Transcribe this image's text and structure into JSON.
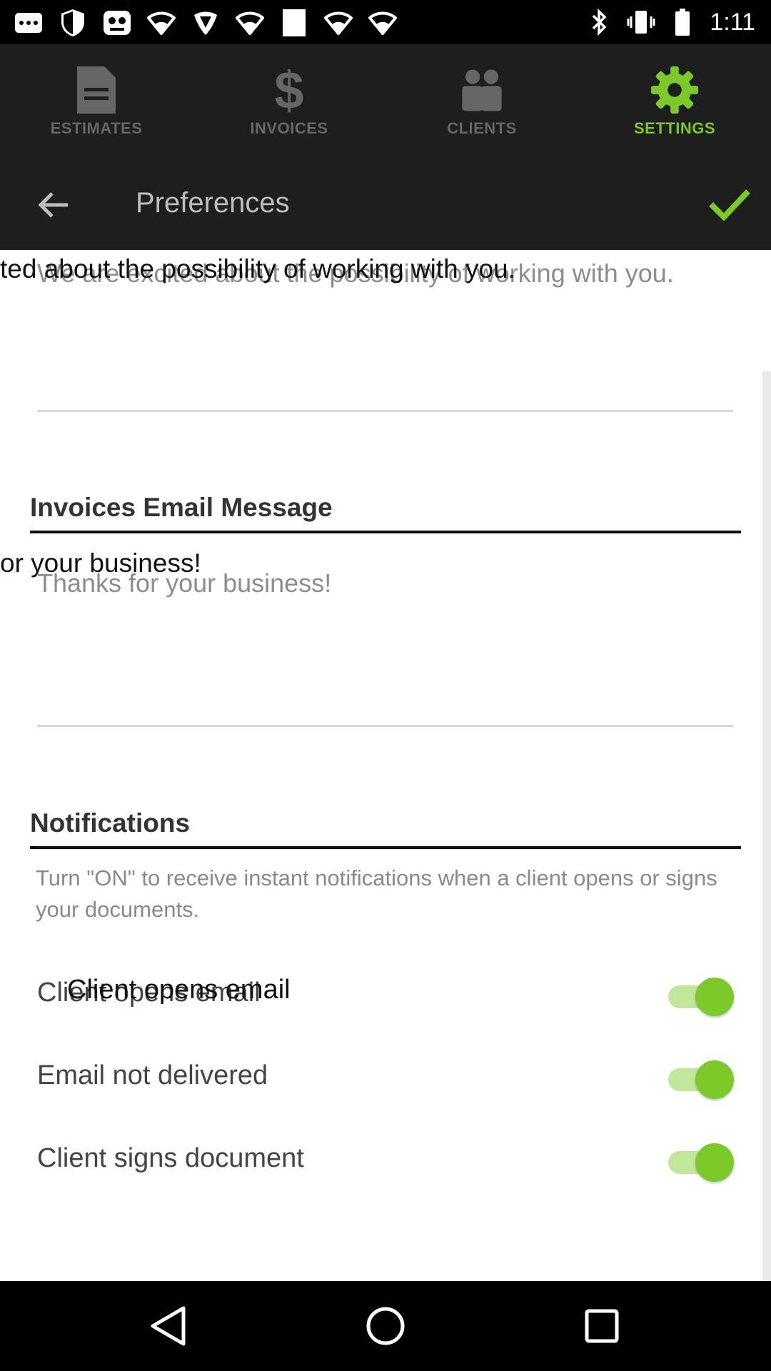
{
  "status_bar": {
    "time": "1:11",
    "icons": [
      "message-icon",
      "shield-icon",
      "app-icon",
      "wifi-icon",
      "houston-texans-icon",
      "wifi-icon",
      "window-icon",
      "wifi-icon",
      "wifi-icon",
      "bluetooth-icon",
      "vibrate-icon",
      "battery-icon"
    ]
  },
  "tabs": [
    {
      "label": "ESTIMATES",
      "icon": "document-icon",
      "active": false
    },
    {
      "label": "INVOICES",
      "icon": "dollar-icon",
      "active": false
    },
    {
      "label": "CLIENTS",
      "icon": "people-icon",
      "active": false
    },
    {
      "label": "SETTINGS",
      "icon": "gear-icon",
      "active": true
    }
  ],
  "toolbar": {
    "title": "Preferences"
  },
  "estimates_email": {
    "value": "We are excited about the possibility of working with you.",
    "overlay_text": "ted about the possibility of working with you."
  },
  "invoices_email": {
    "title": "Invoices Email Message",
    "value": "Thanks for your business!",
    "overlay_text": "or your business!"
  },
  "notifications": {
    "title": "Notifications",
    "description": "Turn \"ON\" to receive instant notifications when a client opens or signs your documents.",
    "items": [
      {
        "label": "Client opens email",
        "overlay": "Client opens email",
        "on": true
      },
      {
        "label": "Email not delivered",
        "on": true
      },
      {
        "label": "Client signs document",
        "on": true
      }
    ]
  },
  "colors": {
    "accent": "#7cc92a",
    "toggle_track": "#c3e79a",
    "header_bg": "#1e1e1e",
    "inactive_tab": "#666666"
  }
}
